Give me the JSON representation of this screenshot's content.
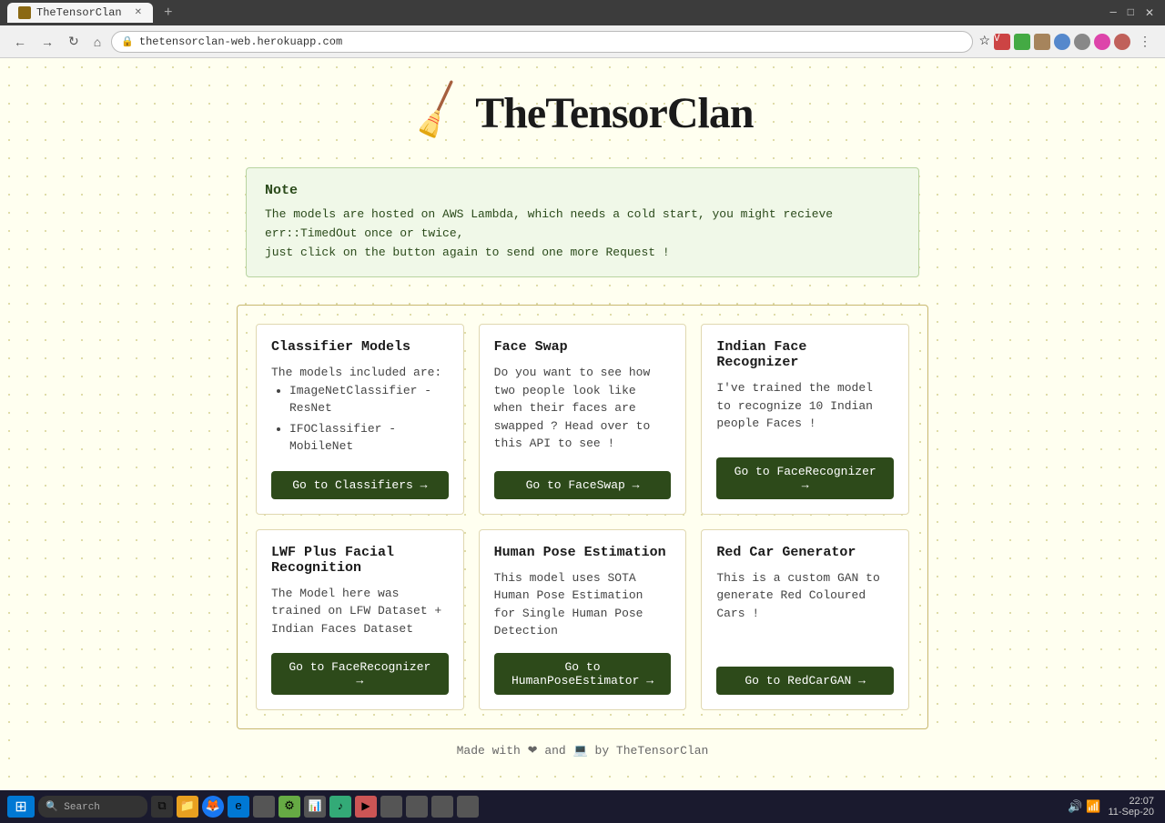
{
  "browser": {
    "tab_title": "TheTensorClan",
    "url": "thetensorclan-web.herokuapp.com",
    "new_tab_symbol": "+"
  },
  "header": {
    "broom_emoji": "🧹",
    "title": "TheTensorClan"
  },
  "note": {
    "title": "Note",
    "text_line1": "The models are hosted on AWS Lambda, which needs a cold start, you might recieve err::TimedOut once or twice,",
    "text_line2": "just click on the button again to send one more Request !"
  },
  "cards": [
    {
      "id": "classifier-models",
      "title": "Classifier Models",
      "desc_intro": "The models included are:",
      "list_items": [
        "ImageNetClassifier - ResNet",
        "IFOClassifier - MobileNet"
      ],
      "button_label": "Go to Classifiers →",
      "button_href": "#"
    },
    {
      "id": "face-swap",
      "title": "Face Swap",
      "desc": "Do you want to see how two people look like when their faces are swapped ? Head over to this API to see !",
      "button_label": "Go to FaceSwap →",
      "button_href": "#"
    },
    {
      "id": "indian-face-recognizer",
      "title": "Indian Face Recognizer",
      "desc": "I've trained the model to recognize 10 Indian people Faces !",
      "button_label": "Go to FaceRecognizer →",
      "button_href": "#"
    },
    {
      "id": "lwf-facial-recognition",
      "title": "LWF Plus Facial Recognition",
      "desc": "The Model here was trained on LFW Dataset + Indian Faces Dataset",
      "button_label": "Go to FaceRecognizer →",
      "button_href": "#"
    },
    {
      "id": "human-pose-estimation",
      "title": "Human Pose Estimation",
      "desc": "This model uses SOTA Human Pose Estimation for Single Human Pose Detection",
      "button_label": "Go to HumanPoseEstimator →",
      "button_href": "#"
    },
    {
      "id": "red-car-generator",
      "title": "Red Car Generator",
      "desc": "This is a custom GAN to generate Red Coloured Cars !",
      "button_label": "Go to RedCarGAN →",
      "button_href": "#"
    }
  ],
  "footer": {
    "text": "Made with ❤ and 💻 by TheTensorClan"
  },
  "taskbar": {
    "time": "22:07",
    "date": "11-Sep-20"
  }
}
